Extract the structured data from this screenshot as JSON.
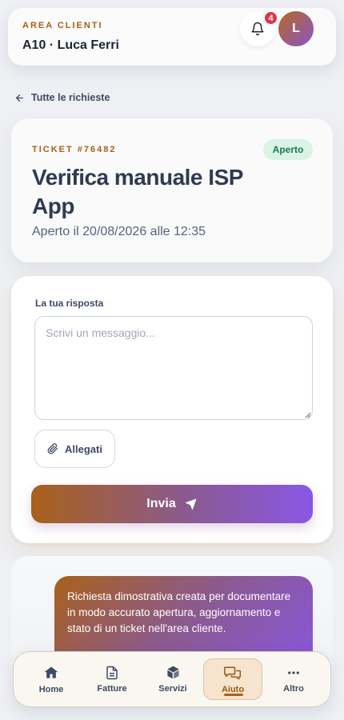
{
  "header": {
    "area_label": "AREA CLIENTI",
    "user_line": "A10 · Luca Ferri",
    "notification_count": "4",
    "avatar_initial": "L"
  },
  "breadcrumb": {
    "back_label": "Tutte le richieste"
  },
  "ticket": {
    "number": "TICKET #76482",
    "status": "Aperto",
    "title": "Verifica manuale ISP App",
    "opened": "Aperto il 20/08/2026 alle 12:35"
  },
  "reply": {
    "label": "La tua risposta",
    "placeholder": "Scrivi un messaggio...",
    "value": "",
    "attach_label": "Allegati",
    "send_label": "Invia"
  },
  "thread": {
    "messages": [
      {
        "text": "Richiesta dimostrativa creata per documentare in modo accurato apertura, aggiornamento e stato di un ticket nell'area cliente."
      }
    ]
  },
  "nav": {
    "items": [
      {
        "label": "Home",
        "icon": "home-icon"
      },
      {
        "label": "Fatture",
        "icon": "invoice-icon"
      },
      {
        "label": "Servizi",
        "icon": "box-icon"
      },
      {
        "label": "Aiuto",
        "icon": "chat-icon",
        "active": true
      },
      {
        "label": "Altro",
        "icon": "more-icon"
      }
    ]
  },
  "colors": {
    "accent_orange": "#a7610f",
    "accent_purple": "#8a57e6",
    "status_green_bg": "#d9f3e6",
    "badge_red": "#e0344b"
  }
}
